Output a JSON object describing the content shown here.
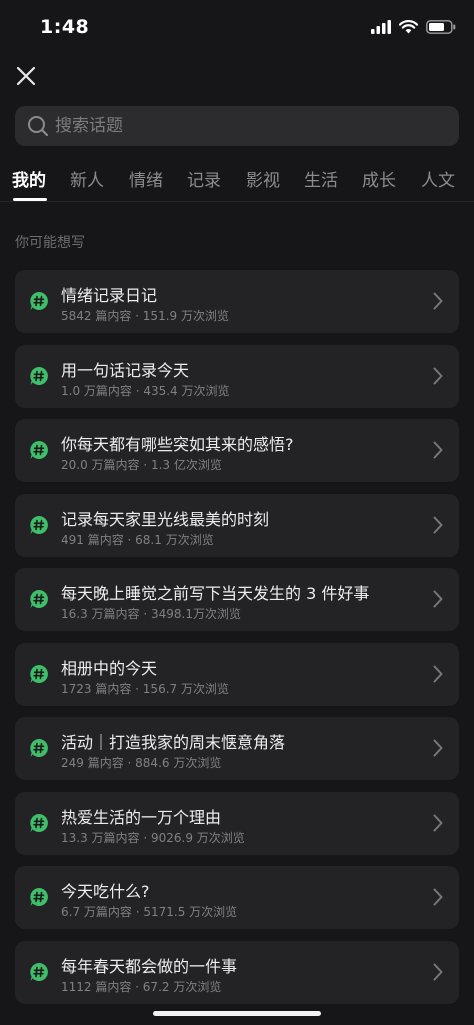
{
  "status_bar": {
    "time": "1:48"
  },
  "search": {
    "placeholder": "搜索话题",
    "value": ""
  },
  "tabs": [
    {
      "label": "我的",
      "active": true
    },
    {
      "label": "新人"
    },
    {
      "label": "情绪"
    },
    {
      "label": "记录"
    },
    {
      "label": "影视"
    },
    {
      "label": "生活"
    },
    {
      "label": "成长"
    },
    {
      "label": "人文"
    }
  ],
  "section_label": "你可能想写",
  "topics": [
    {
      "title": "情绪记录日记",
      "meta": "5842 篇内容 · 151.9 万次浏览"
    },
    {
      "title": "用一句话记录今天",
      "meta": "1.0 万篇内容 · 435.4 万次浏览"
    },
    {
      "title": "你每天都有哪些突如其来的感悟?",
      "meta": "20.0 万篇内容 · 1.3 亿次浏览"
    },
    {
      "title": "记录每天家里光线最美的时刻",
      "meta": "491 篇内容 · 68.1 万次浏览"
    },
    {
      "title": "每天晚上睡觉之前写下当天发生的 3 件好事",
      "meta": "16.3 万篇内容 · 3498.1万次浏览"
    },
    {
      "title": "相册中的今天",
      "meta": "1723 篇内容 · 156.7 万次浏览"
    },
    {
      "title": "活动｜打造我家的周末惬意角落",
      "meta": "249 篇内容 · 884.6 万次浏览"
    },
    {
      "title": "热爱生活的一万个理由",
      "meta": "13.3 万篇内容 · 9026.9 万次浏览"
    },
    {
      "title": "今天吃什么?",
      "meta": "6.7 万篇内容 · 5171.5 万次浏览"
    },
    {
      "title": "每年春天都会做的一件事",
      "meta": "1112 篇内容 · 67.2 万次浏览"
    }
  ],
  "colors": {
    "background": "#161618",
    "card": "#232326",
    "topic_icon": "#3fbf6a"
  }
}
